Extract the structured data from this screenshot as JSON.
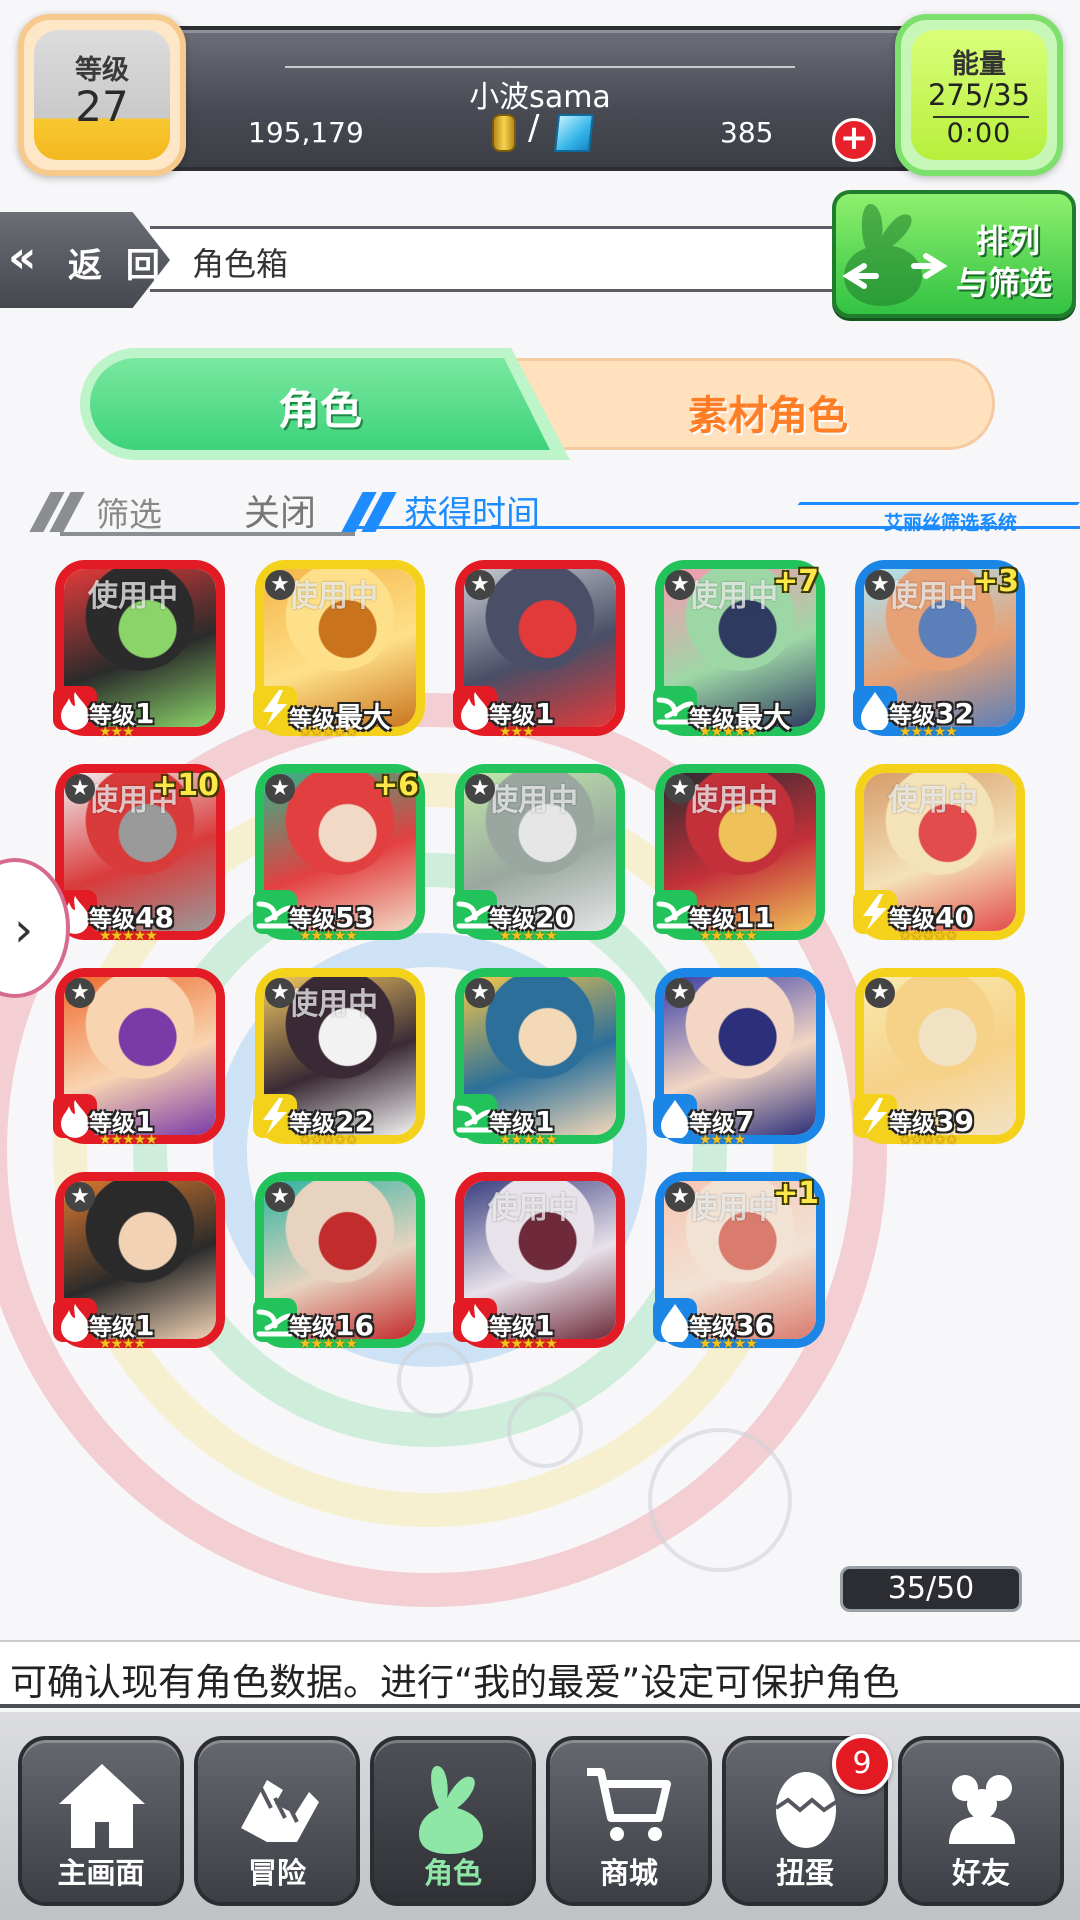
{
  "header": {
    "level_label": "等级",
    "level_value": "27",
    "player_name": "小波sama",
    "coins": "195,179",
    "currency_separator": "/",
    "gems": "385",
    "add_label": "+",
    "energy_label": "能量",
    "energy_value": "275/35",
    "energy_timer": "0:00"
  },
  "nav": {
    "back_label": "返 回",
    "page_title": "角色箱",
    "sort_filter_line1": "排列",
    "sort_filter_line2": "与筛选"
  },
  "tabs": [
    {
      "label": "角色",
      "active": true
    },
    {
      "label": "素材角色",
      "active": false
    }
  ],
  "filter": {
    "label": "筛选",
    "value": "关闭",
    "sort_value": "获得时间",
    "system_label": "艾丽丝筛选系统"
  },
  "characters": [
    {
      "level_prefix": "等级",
      "level": "1",
      "stars": "★★★",
      "in_use": "使用中",
      "plus": "",
      "frame": "#e21b25",
      "element": "fire",
      "art": [
        "#e23a3a",
        "#2b2b2b",
        "#8bd46a"
      ],
      "has_star_badge": false
    },
    {
      "level_prefix": "等级",
      "level": "最大",
      "stars": "★★★★★",
      "in_use": "使用中",
      "plus": "",
      "frame": "#f4d21c",
      "element": "thunder",
      "art": [
        "#f4b548",
        "#ffe08a",
        "#c9741d"
      ],
      "has_star_badge": true
    },
    {
      "level_prefix": "等级",
      "level": "1",
      "stars": "★★★",
      "in_use": "",
      "plus": "",
      "frame": "#e21b25",
      "element": "fire",
      "art": [
        "#c7c9d1",
        "#4a4e66",
        "#e23a3a"
      ],
      "has_star_badge": true
    },
    {
      "level_prefix": "等级",
      "level": "最大",
      "stars": "★★★★★",
      "in_use": "使用中",
      "plus": "+7",
      "frame": "#22c35a",
      "element": "wind",
      "art": [
        "#f59ab0",
        "#9ed7a6",
        "#2f3a60"
      ],
      "has_star_badge": true
    },
    {
      "level_prefix": "等级",
      "level": "32",
      "stars": "★★★★★",
      "in_use": "使用中",
      "plus": "+3",
      "frame": "#1c86e6",
      "element": "water",
      "art": [
        "#aee3f2",
        "#e6a176",
        "#5b7fb8"
      ],
      "has_star_badge": true
    },
    {
      "level_prefix": "等级",
      "level": "48",
      "stars": "★★★★★",
      "in_use": "使用中",
      "plus": "+10",
      "frame": "#e21b25",
      "element": "fire",
      "art": [
        "#f1eef0",
        "#d93a3a",
        "#9a9a9a"
      ],
      "has_star_badge": true
    },
    {
      "level_prefix": "等级",
      "level": "53",
      "stars": "★★★★★",
      "in_use": "",
      "plus": "+6",
      "frame": "#22c35a",
      "element": "wind",
      "art": [
        "#2fb58a",
        "#e24040",
        "#f2d9c6"
      ],
      "has_star_badge": true
    },
    {
      "level_prefix": "等级",
      "level": "20",
      "stars": "★★★★★",
      "in_use": "使用中",
      "plus": "",
      "frame": "#22c35a",
      "element": "wind",
      "art": [
        "#bfe8a8",
        "#9aa7a0",
        "#e6e6e6"
      ],
      "has_star_badge": true
    },
    {
      "level_prefix": "等级",
      "level": "11",
      "stars": "★★★★★",
      "in_use": "使用中",
      "plus": "",
      "frame": "#22c35a",
      "element": "wind",
      "art": [
        "#2b2b30",
        "#c4303a",
        "#eec258"
      ],
      "has_star_badge": true
    },
    {
      "level_prefix": "等级",
      "level": "40",
      "stars": "★★★★★",
      "in_use": "使用中",
      "plus": "",
      "frame": "#f4d21c",
      "element": "thunder",
      "art": [
        "#d69c6a",
        "#f4e2b8",
        "#e34c4c"
      ],
      "has_star_badge": false
    },
    {
      "level_prefix": "等级",
      "level": "1",
      "stars": "★★★★★",
      "in_use": "",
      "plus": "",
      "frame": "#e21b25",
      "element": "fire",
      "art": [
        "#ef6a2e",
        "#f8d4b0",
        "#7a3aa8"
      ],
      "has_star_badge": true
    },
    {
      "level_prefix": "等级",
      "level": "22",
      "stars": "★★★★★",
      "in_use": "使用中",
      "plus": "",
      "frame": "#f4d21c",
      "element": "thunder",
      "art": [
        "#f0c862",
        "#3a2a35",
        "#f2f2f2"
      ],
      "has_star_badge": true
    },
    {
      "level_prefix": "等级",
      "level": "1",
      "stars": "★★★★★",
      "in_use": "",
      "plus": "",
      "frame": "#22c35a",
      "element": "wind",
      "art": [
        "#f4c64a",
        "#2b6f9a",
        "#f4d9b8"
      ],
      "has_star_badge": true
    },
    {
      "level_prefix": "等级",
      "level": "7",
      "stars": "★★★★",
      "in_use": "",
      "plus": "",
      "frame": "#1c86e6",
      "element": "water",
      "art": [
        "#3a3fa8",
        "#f3d6c4",
        "#2c2f7a"
      ],
      "has_star_badge": true
    },
    {
      "level_prefix": "等级",
      "level": "39",
      "stars": "★★★★★",
      "in_use": "",
      "plus": "",
      "frame": "#f4d21c",
      "element": "thunder",
      "art": [
        "#f8eab0",
        "#f6d188",
        "#f2e2c4"
      ],
      "has_star_badge": true
    },
    {
      "level_prefix": "等级",
      "level": "1",
      "stars": "★★★★",
      "in_use": "",
      "plus": "",
      "frame": "#e21b25",
      "element": "fire",
      "art": [
        "#d9782e",
        "#2a2a2a",
        "#f1d2b4"
      ],
      "has_star_badge": true
    },
    {
      "level_prefix": "等级",
      "level": "16",
      "stars": "★★★★★",
      "in_use": "",
      "plus": "",
      "frame": "#22c35a",
      "element": "wind",
      "art": [
        "#2fb3a0",
        "#e7d3c0",
        "#c32c2c"
      ],
      "has_star_badge": true
    },
    {
      "level_prefix": "等级",
      "level": "1",
      "stars": "★★★★★",
      "in_use": "使用中",
      "plus": "",
      "frame": "#e21b25",
      "element": "fire",
      "art": [
        "#3b3f80",
        "#e8e2ea",
        "#6e2a3a"
      ],
      "has_star_badge": false
    },
    {
      "level_prefix": "等级",
      "level": "36",
      "stars": "★★★★★",
      "in_use": "使用中",
      "plus": "+1",
      "frame": "#1c86e6",
      "element": "water",
      "art": [
        "#f6c5b2",
        "#f2e2d4",
        "#d97b6d"
      ],
      "has_star_badge": true
    }
  ],
  "counter": "35/50",
  "ticker": "可确认现有角色数据。进行“我的最爱”设定可保护角色",
  "bottom_nav": [
    {
      "label": "主画面",
      "icon": "home-icon"
    },
    {
      "label": "冒险",
      "icon": "handshake-icon"
    },
    {
      "label": "角色",
      "icon": "rabbit-icon",
      "active": true
    },
    {
      "label": "商城",
      "icon": "cart-icon"
    },
    {
      "label": "扭蛋",
      "icon": "egg-icon"
    },
    {
      "label": "好友",
      "icon": "friends-icon"
    }
  ],
  "gacha_badge": "9",
  "colors": {
    "fire": "#e21b25",
    "thunder": "#f4d21c",
    "wind": "#22c35a",
    "water": "#1c86e6",
    "accent": "#1a8cff"
  }
}
